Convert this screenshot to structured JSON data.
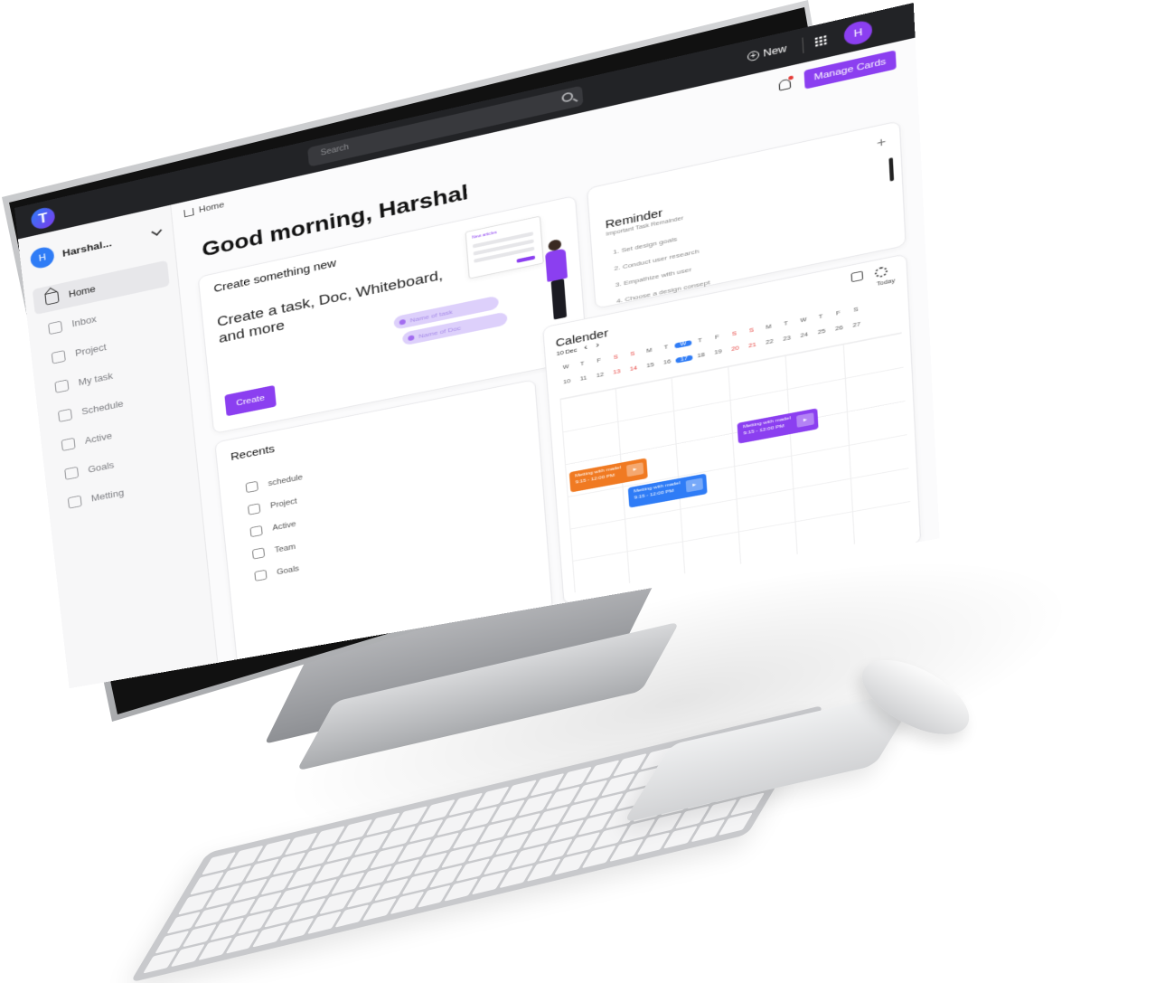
{
  "topbar": {
    "search_placeholder": "Search",
    "new_label": "New",
    "avatar_initial": "H"
  },
  "sidebar": {
    "user_initial": "H",
    "user_name": "Harshal...",
    "items": [
      {
        "label": "Home",
        "icon": "home-icon"
      },
      {
        "label": "Inbox",
        "icon": "inbox-icon"
      },
      {
        "label": "Project",
        "icon": "folder-icon"
      },
      {
        "label": "My task",
        "icon": "task-icon"
      },
      {
        "label": "Schedule",
        "icon": "calendar-icon"
      },
      {
        "label": "Active",
        "icon": "people-icon"
      },
      {
        "label": "Goals",
        "icon": "trophy-icon"
      },
      {
        "label": "Metting",
        "icon": "video-icon"
      }
    ]
  },
  "header": {
    "breadcrumb": "Home",
    "manage_cards_label": "Manage Cards"
  },
  "greeting": "Good morning, Harshal",
  "create_card": {
    "title": "Create something new",
    "text": "Create a task, Doc, Whiteboard, and more",
    "button_label": "Create",
    "pill_1": "Name of task",
    "pill_2": "Name of Doc",
    "mock_window_title": "New articles"
  },
  "recents": {
    "title": "Recents",
    "items": [
      {
        "label": "schedule",
        "icon": "calendar-icon"
      },
      {
        "label": "Project",
        "icon": "folder-icon"
      },
      {
        "label": "Active",
        "icon": "people-icon"
      },
      {
        "label": "Team",
        "icon": "team-icon"
      },
      {
        "label": "Goals",
        "icon": "trophy-icon"
      }
    ]
  },
  "reminder": {
    "title": "Reminder",
    "subtitle": "Important Task Remainder",
    "items": [
      "1. Set design goals",
      "2. Conduct user research",
      "3. Empathize with user",
      "4. Choose a design consept"
    ]
  },
  "calendar": {
    "title": "Calender",
    "month": "10 Dec",
    "today_label": "Today",
    "days": [
      "W",
      "T",
      "F",
      "S",
      "S",
      "M",
      "T",
      "W",
      "T",
      "F",
      "S",
      "S",
      "M",
      "T",
      "W",
      "T",
      "F",
      "S"
    ],
    "dates": [
      "10",
      "11",
      "12",
      "13",
      "14",
      "15",
      "16",
      "17",
      "18",
      "19",
      "20",
      "21",
      "22",
      "23",
      "24",
      "25",
      "26",
      "27"
    ],
    "red_indices": [
      3,
      4,
      10,
      11
    ],
    "selected_index": 7,
    "events": [
      {
        "title": "Metting with madel",
        "time": "9:15 - 12:00 PM",
        "color": "#f07a22"
      },
      {
        "title": "Metting with madel",
        "time": "9:15 - 12:00 PM",
        "color": "#2f7cf6"
      },
      {
        "title": "Metting with madel",
        "time": "9:15 - 12:00 PM",
        "color": "#8b3ff0"
      }
    ]
  },
  "colors": {
    "accent": "#8b3ff0",
    "primary_blue": "#2f7cf6",
    "topbar": "#222326"
  }
}
